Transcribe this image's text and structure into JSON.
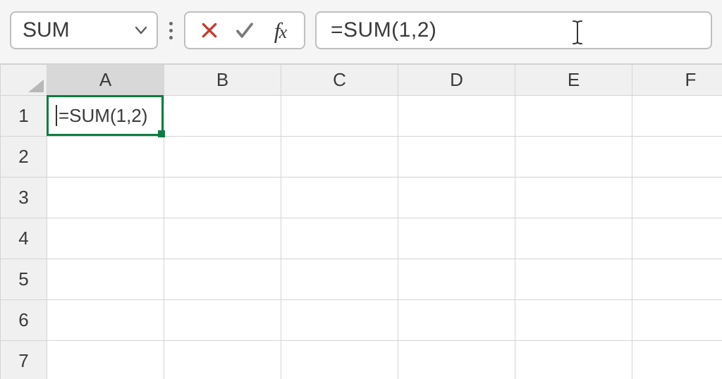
{
  "nameBox": {
    "value": "SUM"
  },
  "formulaBar": {
    "value": "=SUM(1,2)"
  },
  "columns": [
    "A",
    "B",
    "C",
    "D",
    "E",
    "F"
  ],
  "rows": [
    "1",
    "2",
    "3",
    "4",
    "5",
    "6",
    "7"
  ],
  "activeCell": {
    "ref": "A1",
    "editingText": "=SUM(1,2)"
  },
  "colors": {
    "selectionGreen": "#107c41",
    "cancelRed": "#c23b2e",
    "confirmGray": "#6a6a6a"
  }
}
